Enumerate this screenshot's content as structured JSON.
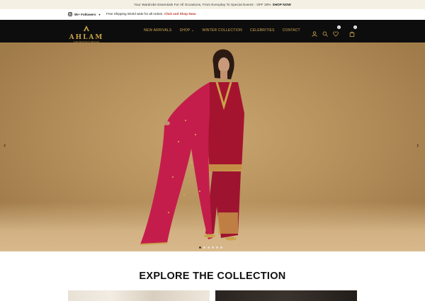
{
  "announcement": {
    "text": "Your Wardrobe Essentials For All Occasions, From Everyday To Special Events - OFF 20%",
    "cta": "SHOP NOW"
  },
  "infobar": {
    "followers": "9k+ Followers",
    "shipping_text": "Free Shipping World wide for all orders.",
    "shipping_link": "Click and Shop Now."
  },
  "brand": {
    "name": "AHLAM",
    "tagline": "THE PEOPLE'S DESIGN",
    "accent": "#c9a24a"
  },
  "nav": {
    "items": [
      {
        "label": "NEW ARRIVALS"
      },
      {
        "label": "SHOP"
      },
      {
        "label": "WINTER COLLECTION"
      },
      {
        "label": "CELEBRITIES"
      },
      {
        "label": "CONTACT"
      }
    ]
  },
  "header_icons": {
    "wishlist_count": "0",
    "cart_count": "0"
  },
  "hero": {
    "slide_count": 6,
    "active_slide": 1
  },
  "section": {
    "title": "EXPLORE THE COLLECTION"
  }
}
